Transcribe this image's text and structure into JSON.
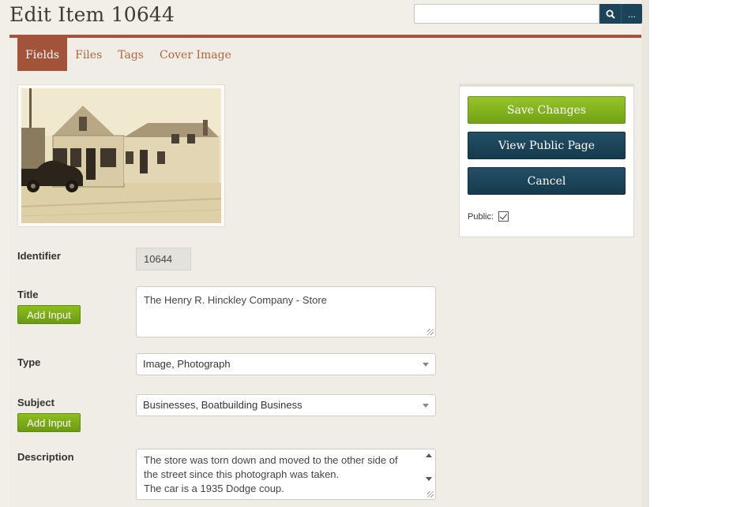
{
  "page": {
    "title": "Edit Item 10644"
  },
  "search": {
    "placeholder": "",
    "search_icon": "magnifier-icon",
    "more_label": "..."
  },
  "tabs": [
    {
      "label": "Fields",
      "active": true
    },
    {
      "label": "Files",
      "active": false
    },
    {
      "label": "Tags",
      "active": false
    },
    {
      "label": "Cover Image",
      "active": false
    }
  ],
  "fields": {
    "identifier": {
      "label": "Identifier",
      "value": "10644"
    },
    "title": {
      "label": "Title",
      "value": "The Henry R. Hinckley Company - Store",
      "add_label": "Add Input"
    },
    "type": {
      "label": "Type",
      "value": "Image, Photograph"
    },
    "subject": {
      "label": "Subject",
      "value": "Businesses, Boatbuilding Business",
      "add_label": "Add Input"
    },
    "description": {
      "label": "Description",
      "line1": "The store was torn down and moved to the other side of",
      "line2": "the street since this photograph was taken.",
      "line3": "The car is a 1935 Dodge coup."
    }
  },
  "panel": {
    "save_label": "Save Changes",
    "view_label": "View Public Page",
    "cancel_label": "Cancel",
    "public_label": "Public:",
    "public_checked": true
  },
  "colors": {
    "accent": "#a3533a",
    "green": "#7aab17",
    "navy": "#1c4459"
  }
}
